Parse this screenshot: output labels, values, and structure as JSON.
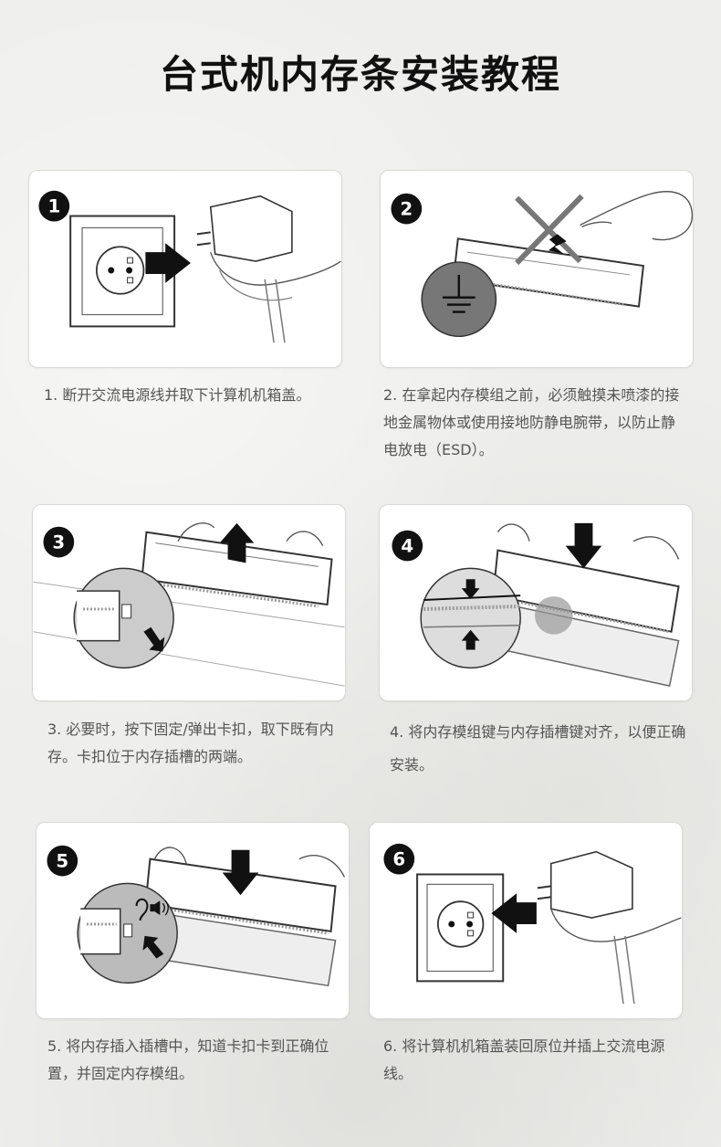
{
  "title": "台式机内存条安装教程",
  "steps": [
    {
      "number": "1",
      "text": "1. 断开交流电源线并取下计算机机箱盖。"
    },
    {
      "number": "2",
      "text": "2. 在拿起内存模组之前，必须触摸未喷漆的接地金属物体或使用接地防静电腕带，以防止静电放电（ESD）。"
    },
    {
      "number": "3",
      "text": "3. 必要时，按下固定/弹出卡扣，取下既有内存。卡扣位于内存插槽的两端。"
    },
    {
      "number": "4",
      "text": "4. 将内存模组键与内存插槽键对齐，以便正确安装。"
    },
    {
      "number": "5",
      "text": "5. 将内存插入插槽中，知道卡扣卡到正确位置，并固定内存模组。"
    },
    {
      "number": "6",
      "text": "6. 将计算机机箱盖装回原位并插上交流电源线。"
    }
  ]
}
